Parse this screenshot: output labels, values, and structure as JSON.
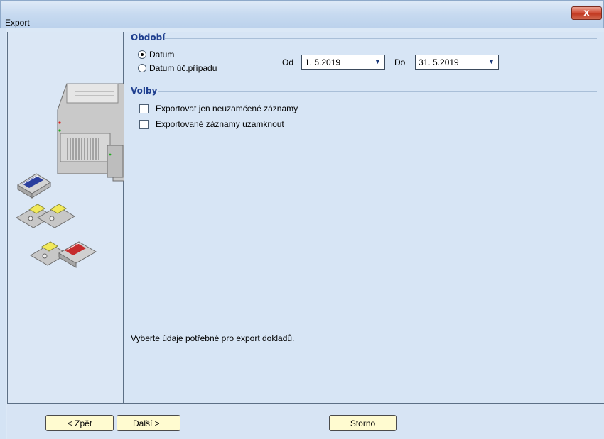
{
  "window": {
    "title": "Export",
    "close_label": "x"
  },
  "period": {
    "group_label": "Období",
    "options": [
      {
        "label": "Datum",
        "checked": true
      },
      {
        "label": "Datum úč.případu",
        "checked": false
      }
    ],
    "from_label": "Od",
    "from_value": "1. 5.2019",
    "to_label": "Do",
    "to_value": "31. 5.2019"
  },
  "options": {
    "group_label": "Volby",
    "items": [
      {
        "label": "Exportovat jen neuzamčené záznamy",
        "checked": false
      },
      {
        "label": "Exportované záznamy uzamknout",
        "checked": false
      }
    ]
  },
  "info_text": "Vyberte údaje potřebné pro export dokladů.",
  "buttons": {
    "back": "< Zpět",
    "next": "Další >",
    "cancel": "Storno"
  },
  "colors": {
    "group_label": "#1f3f8f",
    "button_bg": "#fffbd0",
    "close_button": "#c23a22"
  }
}
